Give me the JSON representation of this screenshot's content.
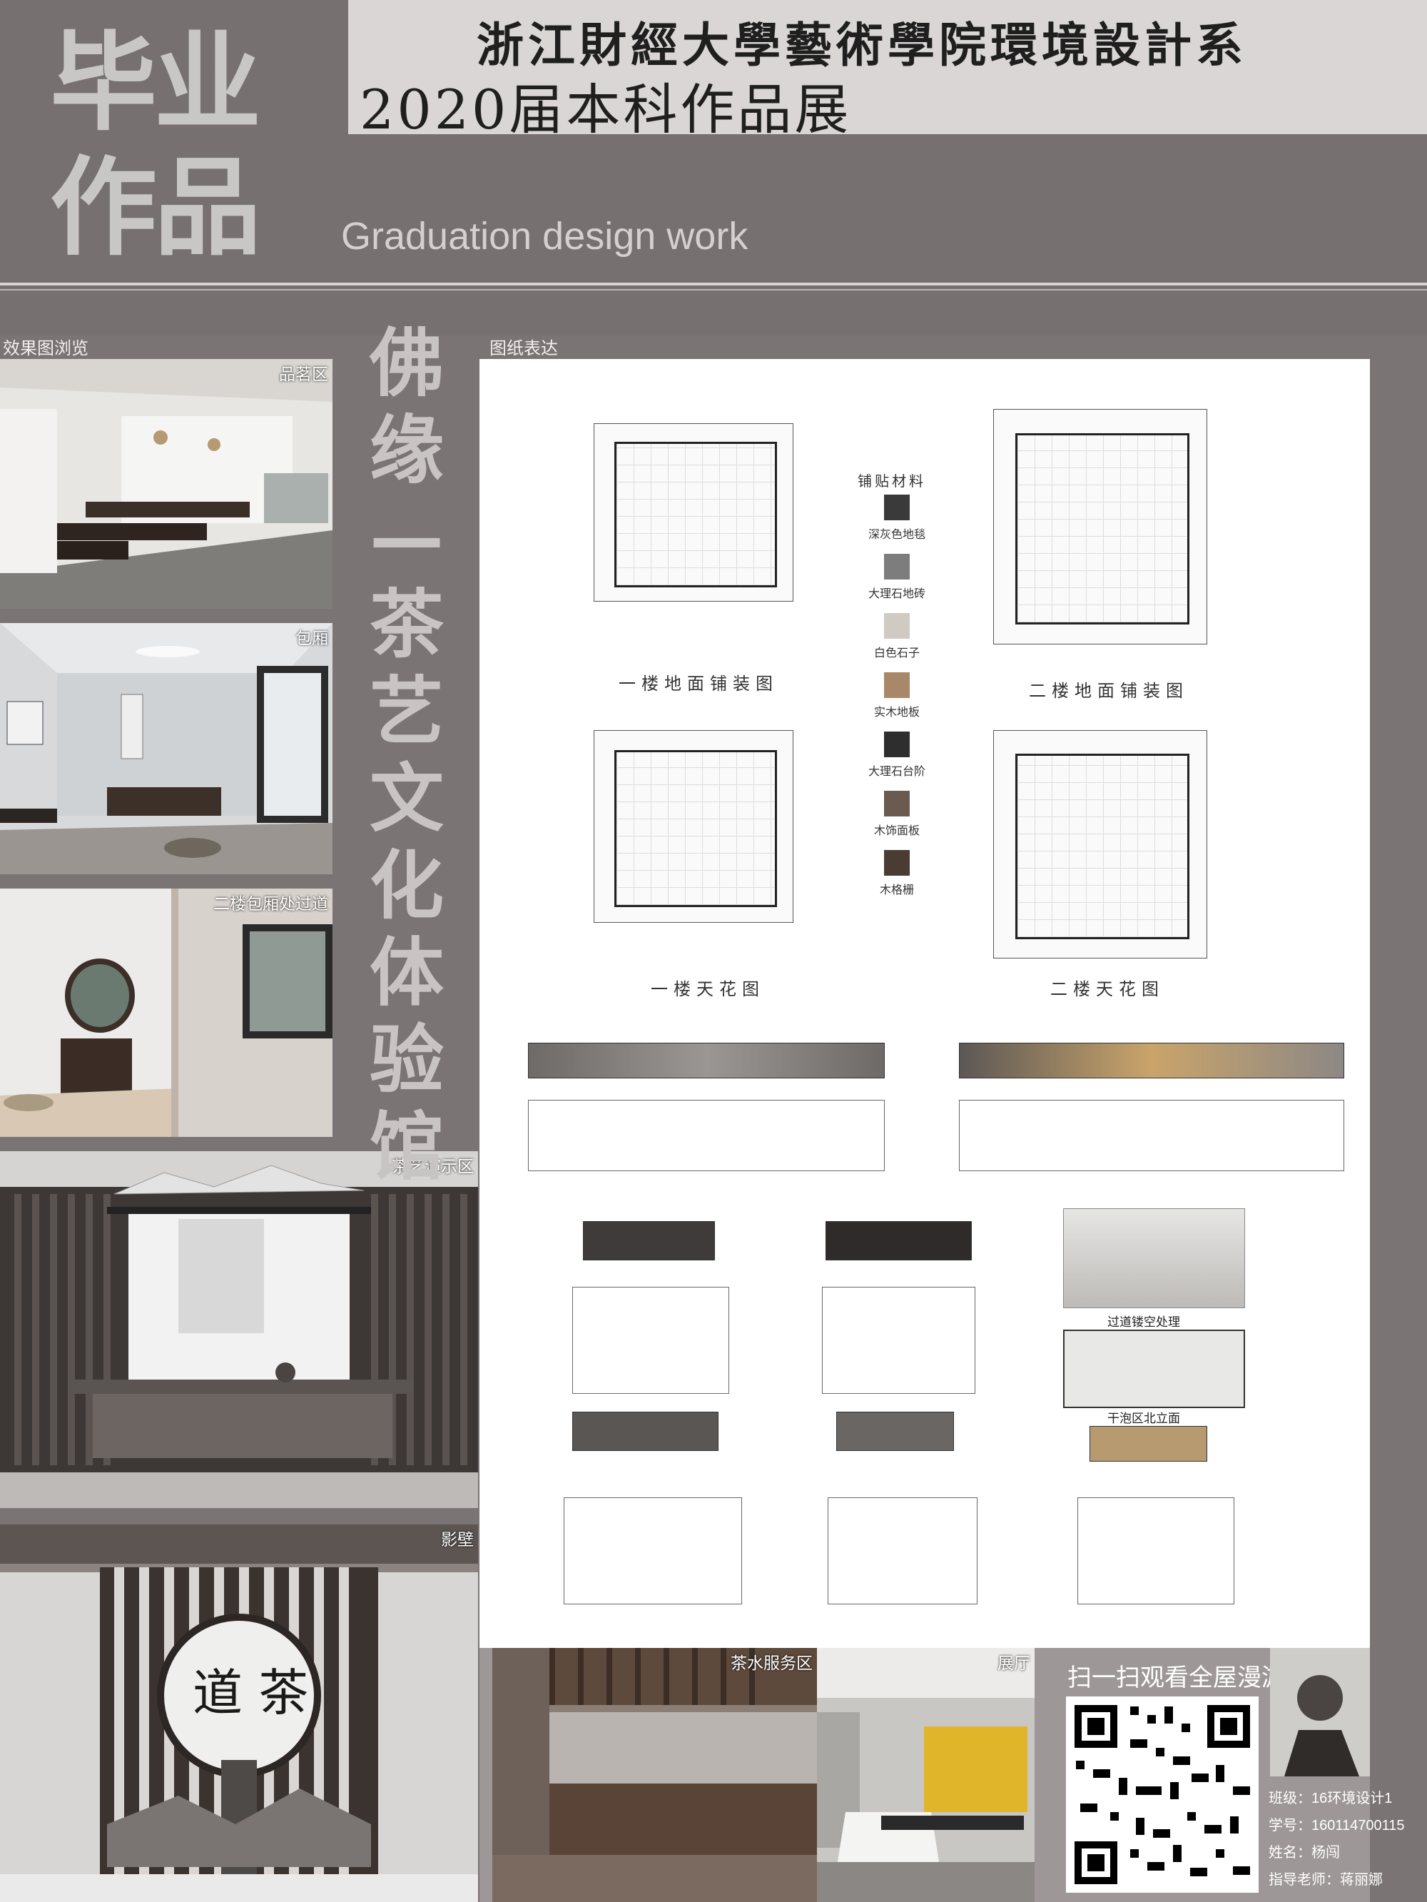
{
  "header": {
    "big_title": "毕业作品",
    "school": "浙江財經大學藝術學院環境設計系",
    "year_line": "2020届本科作品展",
    "subtitle_en": "Graduation design work"
  },
  "left_section": {
    "label": "效果图浏览",
    "photos": [
      {
        "caption": "品茗区"
      },
      {
        "caption": "包厢"
      },
      {
        "caption": "二楼包厢处过道"
      },
      {
        "caption": "茶艺演示区"
      },
      {
        "caption": "影壁"
      }
    ]
  },
  "vertical_title": "佛缘—茶艺文化体验馆",
  "drawings": {
    "label": "图纸表达",
    "plans": [
      {
        "title": "一楼地面铺装图"
      },
      {
        "title": "二楼地面铺装图"
      },
      {
        "title": "一楼天花图"
      },
      {
        "title": "二楼天花图"
      }
    ],
    "materials_title": "铺贴材料",
    "materials": [
      {
        "name": "深灰色地毯",
        "color": "#3a3a3a"
      },
      {
        "name": "大理石地砖",
        "color": "#7d7d7d"
      },
      {
        "name": "白色石子",
        "color": "#cfcac2"
      },
      {
        "name": "实木地板",
        "color": "#a88868"
      },
      {
        "name": "大理石台阶",
        "color": "#2e2e2e"
      },
      {
        "name": "木饰面板",
        "color": "#6b5a4f"
      },
      {
        "name": "木格栅",
        "color": "#4a3b33"
      }
    ],
    "image_captions": [
      "过道镂空处理",
      "干泡区北立面"
    ]
  },
  "bottom": {
    "photos": [
      {
        "caption": "茶水服务区"
      },
      {
        "caption": "展厅"
      }
    ],
    "qr_title": "扫一扫观看全屋漫游",
    "info": {
      "class": "班级：16环境设计1",
      "id": "学号：160114700115",
      "name": "姓名：杨闯",
      "teacher": "指导老师：蒋丽娜"
    }
  }
}
